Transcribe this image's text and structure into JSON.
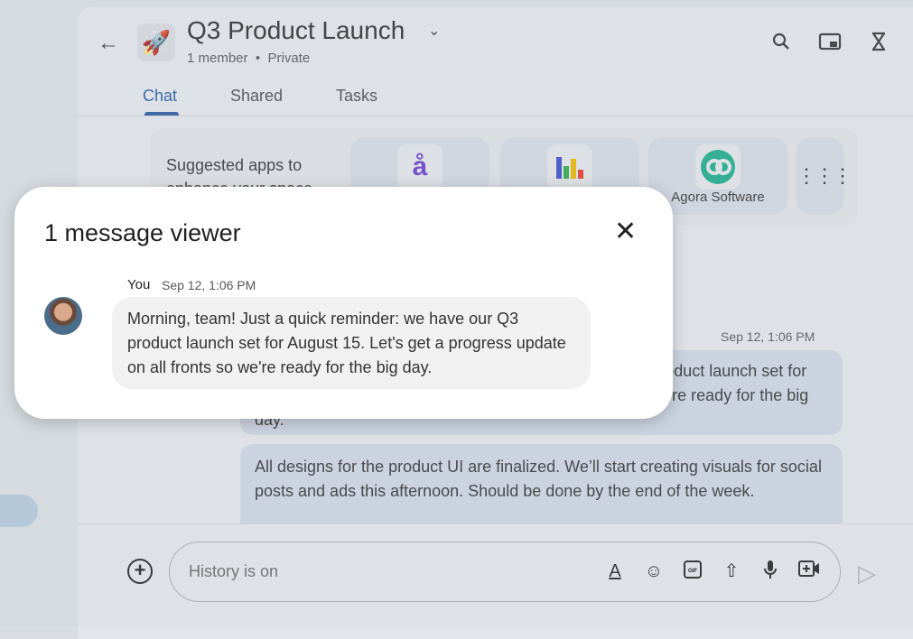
{
  "header": {
    "title": "Q3 Product Launch",
    "members": "1 member",
    "visibility": "Private",
    "separator": "•",
    "logo_icon": "rocket-icon",
    "back_icon": "arrow-left-icon"
  },
  "tabs": [
    {
      "label": "Chat",
      "active": true
    },
    {
      "label": "Shared"
    },
    {
      "label": "Tasks"
    }
  ],
  "suggested_apps": {
    "text": "Suggested apps to enhance your space",
    "apps": [
      {
        "name": "",
        "icon": "å"
      },
      {
        "name": "",
        "icon": "bar-chart"
      },
      {
        "name": "Agora Software",
        "icon": "agora-logo"
      }
    ]
  },
  "messages": [
    {
      "timestamp": "Sep 12, 1:06 PM",
      "text": "Morning, team! Just a quick reminder: we have our Q3 product launch set for August 15. Let's get a progress update on all fronts so we're ready for the big day."
    },
    {
      "text": "All designs for the product UI are finalized. We’ll start creating visuals for social posts and ads this afternoon. Should be done by the end of the week."
    }
  ],
  "composer": {
    "placeholder": "History is on"
  },
  "dialog": {
    "title": "1 message viewer",
    "sender": "You",
    "timestamp": "Sep 12, 1:06 PM",
    "text": "Morning, team! Just a quick reminder: we have our Q3 product launch set for August 15. Let's get a progress update on all fronts so we're ready for the big day."
  },
  "colors": {
    "accent": "#27569e",
    "bubble": "#ccd4e2",
    "agora": "#1aa88a"
  }
}
